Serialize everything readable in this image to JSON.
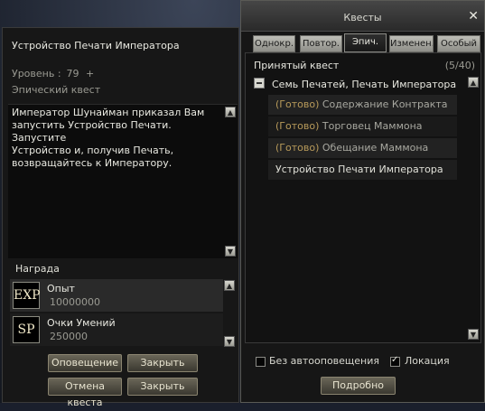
{
  "detail": {
    "title": "Устройство Печати Императора",
    "level_label": "Уровень :",
    "level_value": "79",
    "level_plus": "+",
    "quest_type": "Эпический квест",
    "description": "Император Шунайман приказал Вам\nзапустить Устройство Печати. Запустите\nУстройство и, получив Печать,\nвозвращайтесь к Императору.",
    "reward_label": "Награда",
    "rewards": [
      {
        "icon_text": "EXP",
        "icon": "exp-icon",
        "name": "Опыт",
        "value": "10000000"
      },
      {
        "icon_text": "SP",
        "icon": "sp-icon",
        "name": "Очки Умений",
        "value": "250000"
      }
    ],
    "buttons": {
      "notify": "Оповещение",
      "close1": "Закрыть",
      "cancel_quest": "Отмена квеста",
      "close2": "Закрыть"
    }
  },
  "quest_window": {
    "title": "Квесты",
    "close_glyph": "✕",
    "tabs": [
      "Однокр.",
      "Повтор.",
      "Эпич.",
      "Изменен.",
      "Особый"
    ],
    "active_tab": "Эпич.",
    "accepted_label": "Принятый квест",
    "count": "(5/40)",
    "group": "Семь Печатей, Печать Императора",
    "ready_prefix": "(Готово)",
    "items": [
      {
        "ready": true,
        "name": "Содержание Контракта"
      },
      {
        "ready": true,
        "name": "Торговец Маммона"
      },
      {
        "ready": true,
        "name": "Обещание Маммона"
      },
      {
        "ready": false,
        "name": "Устройство Печати Императора"
      }
    ],
    "options": {
      "no_autonotify": "Без автооповещения",
      "no_autonotify_checked": false,
      "location": "Локация",
      "location_checked": true
    },
    "details_button": "Подробно"
  },
  "colors": {
    "ready": "#b89a5a",
    "button_border": "#8a8470"
  }
}
